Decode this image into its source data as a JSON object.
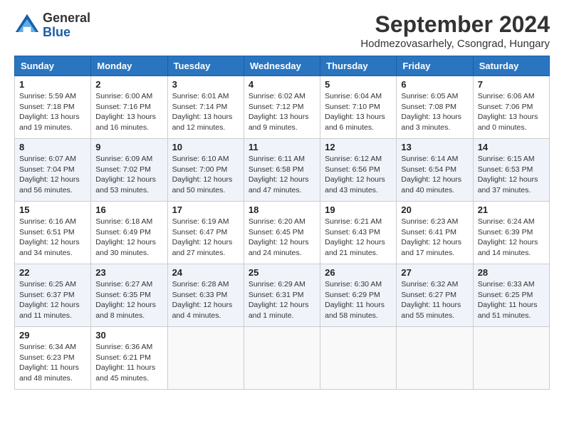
{
  "header": {
    "logo_general": "General",
    "logo_blue": "Blue",
    "month_title": "September 2024",
    "location": "Hodmezovasarhely, Csongrad, Hungary"
  },
  "days_of_week": [
    "Sunday",
    "Monday",
    "Tuesday",
    "Wednesday",
    "Thursday",
    "Friday",
    "Saturday"
  ],
  "weeks": [
    [
      {
        "day": "1",
        "info": "Sunrise: 5:59 AM\nSunset: 7:18 PM\nDaylight: 13 hours and 19 minutes."
      },
      {
        "day": "2",
        "info": "Sunrise: 6:00 AM\nSunset: 7:16 PM\nDaylight: 13 hours and 16 minutes."
      },
      {
        "day": "3",
        "info": "Sunrise: 6:01 AM\nSunset: 7:14 PM\nDaylight: 13 hours and 12 minutes."
      },
      {
        "day": "4",
        "info": "Sunrise: 6:02 AM\nSunset: 7:12 PM\nDaylight: 13 hours and 9 minutes."
      },
      {
        "day": "5",
        "info": "Sunrise: 6:04 AM\nSunset: 7:10 PM\nDaylight: 13 hours and 6 minutes."
      },
      {
        "day": "6",
        "info": "Sunrise: 6:05 AM\nSunset: 7:08 PM\nDaylight: 13 hours and 3 minutes."
      },
      {
        "day": "7",
        "info": "Sunrise: 6:06 AM\nSunset: 7:06 PM\nDaylight: 13 hours and 0 minutes."
      }
    ],
    [
      {
        "day": "8",
        "info": "Sunrise: 6:07 AM\nSunset: 7:04 PM\nDaylight: 12 hours and 56 minutes."
      },
      {
        "day": "9",
        "info": "Sunrise: 6:09 AM\nSunset: 7:02 PM\nDaylight: 12 hours and 53 minutes."
      },
      {
        "day": "10",
        "info": "Sunrise: 6:10 AM\nSunset: 7:00 PM\nDaylight: 12 hours and 50 minutes."
      },
      {
        "day": "11",
        "info": "Sunrise: 6:11 AM\nSunset: 6:58 PM\nDaylight: 12 hours and 47 minutes."
      },
      {
        "day": "12",
        "info": "Sunrise: 6:12 AM\nSunset: 6:56 PM\nDaylight: 12 hours and 43 minutes."
      },
      {
        "day": "13",
        "info": "Sunrise: 6:14 AM\nSunset: 6:54 PM\nDaylight: 12 hours and 40 minutes."
      },
      {
        "day": "14",
        "info": "Sunrise: 6:15 AM\nSunset: 6:53 PM\nDaylight: 12 hours and 37 minutes."
      }
    ],
    [
      {
        "day": "15",
        "info": "Sunrise: 6:16 AM\nSunset: 6:51 PM\nDaylight: 12 hours and 34 minutes."
      },
      {
        "day": "16",
        "info": "Sunrise: 6:18 AM\nSunset: 6:49 PM\nDaylight: 12 hours and 30 minutes."
      },
      {
        "day": "17",
        "info": "Sunrise: 6:19 AM\nSunset: 6:47 PM\nDaylight: 12 hours and 27 minutes."
      },
      {
        "day": "18",
        "info": "Sunrise: 6:20 AM\nSunset: 6:45 PM\nDaylight: 12 hours and 24 minutes."
      },
      {
        "day": "19",
        "info": "Sunrise: 6:21 AM\nSunset: 6:43 PM\nDaylight: 12 hours and 21 minutes."
      },
      {
        "day": "20",
        "info": "Sunrise: 6:23 AM\nSunset: 6:41 PM\nDaylight: 12 hours and 17 minutes."
      },
      {
        "day": "21",
        "info": "Sunrise: 6:24 AM\nSunset: 6:39 PM\nDaylight: 12 hours and 14 minutes."
      }
    ],
    [
      {
        "day": "22",
        "info": "Sunrise: 6:25 AM\nSunset: 6:37 PM\nDaylight: 12 hours and 11 minutes."
      },
      {
        "day": "23",
        "info": "Sunrise: 6:27 AM\nSunset: 6:35 PM\nDaylight: 12 hours and 8 minutes."
      },
      {
        "day": "24",
        "info": "Sunrise: 6:28 AM\nSunset: 6:33 PM\nDaylight: 12 hours and 4 minutes."
      },
      {
        "day": "25",
        "info": "Sunrise: 6:29 AM\nSunset: 6:31 PM\nDaylight: 12 hours and 1 minute."
      },
      {
        "day": "26",
        "info": "Sunrise: 6:30 AM\nSunset: 6:29 PM\nDaylight: 11 hours and 58 minutes."
      },
      {
        "day": "27",
        "info": "Sunrise: 6:32 AM\nSunset: 6:27 PM\nDaylight: 11 hours and 55 minutes."
      },
      {
        "day": "28",
        "info": "Sunrise: 6:33 AM\nSunset: 6:25 PM\nDaylight: 11 hours and 51 minutes."
      }
    ],
    [
      {
        "day": "29",
        "info": "Sunrise: 6:34 AM\nSunset: 6:23 PM\nDaylight: 11 hours and 48 minutes."
      },
      {
        "day": "30",
        "info": "Sunrise: 6:36 AM\nSunset: 6:21 PM\nDaylight: 11 hours and 45 minutes."
      },
      {
        "day": "",
        "info": ""
      },
      {
        "day": "",
        "info": ""
      },
      {
        "day": "",
        "info": ""
      },
      {
        "day": "",
        "info": ""
      },
      {
        "day": "",
        "info": ""
      }
    ]
  ]
}
